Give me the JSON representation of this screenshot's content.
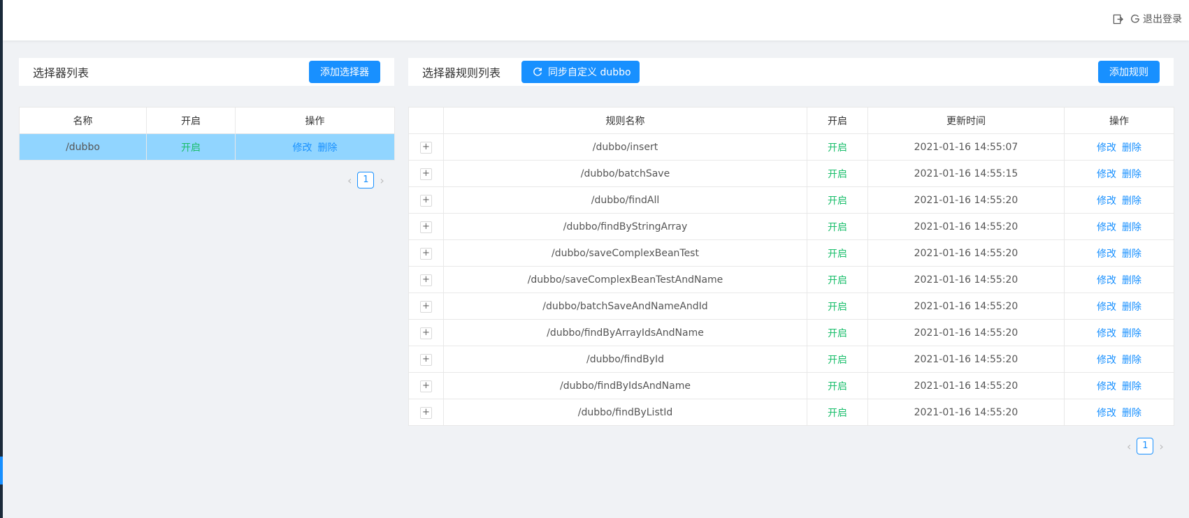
{
  "header": {
    "logout_label": "退出登录"
  },
  "selector_panel": {
    "title": "选择器列表",
    "add_button": "添加选择器",
    "columns": [
      "名称",
      "开启",
      "操作"
    ],
    "rows": [
      {
        "name": "/dubbo",
        "status": "开启",
        "edit": "修改",
        "delete": "删除"
      }
    ],
    "page": "1"
  },
  "rule_panel": {
    "title": "选择器规则列表",
    "sync_button": "同步自定义 dubbo",
    "add_button": "添加规则",
    "columns": [
      "",
      "规则名称",
      "开启",
      "更新时间",
      "操作"
    ],
    "rows": [
      {
        "name": "/dubbo/insert",
        "status": "开启",
        "time": "2021-01-16 14:55:07",
        "edit": "修改",
        "delete": "删除"
      },
      {
        "name": "/dubbo/batchSave",
        "status": "开启",
        "time": "2021-01-16 14:55:15",
        "edit": "修改",
        "delete": "删除"
      },
      {
        "name": "/dubbo/findAll",
        "status": "开启",
        "time": "2021-01-16 14:55:20",
        "edit": "修改",
        "delete": "删除"
      },
      {
        "name": "/dubbo/findByStringArray",
        "status": "开启",
        "time": "2021-01-16 14:55:20",
        "edit": "修改",
        "delete": "删除"
      },
      {
        "name": "/dubbo/saveComplexBeanTest",
        "status": "开启",
        "time": "2021-01-16 14:55:20",
        "edit": "修改",
        "delete": "删除"
      },
      {
        "name": "/dubbo/saveComplexBeanTestAndName",
        "status": "开启",
        "time": "2021-01-16 14:55:20",
        "edit": "修改",
        "delete": "删除"
      },
      {
        "name": "/dubbo/batchSaveAndNameAndId",
        "status": "开启",
        "time": "2021-01-16 14:55:20",
        "edit": "修改",
        "delete": "删除"
      },
      {
        "name": "/dubbo/findByArrayIdsAndName",
        "status": "开启",
        "time": "2021-01-16 14:55:20",
        "edit": "修改",
        "delete": "删除"
      },
      {
        "name": "/dubbo/findById",
        "status": "开启",
        "time": "2021-01-16 14:55:20",
        "edit": "修改",
        "delete": "删除"
      },
      {
        "name": "/dubbo/findByIdsAndName",
        "status": "开启",
        "time": "2021-01-16 14:55:20",
        "edit": "修改",
        "delete": "删除"
      },
      {
        "name": "/dubbo/findByListId",
        "status": "开启",
        "time": "2021-01-16 14:55:20",
        "edit": "修改",
        "delete": "删除"
      }
    ],
    "expand_symbol": "+",
    "page": "1"
  },
  "icons": {
    "export": "export-icon",
    "logout": "logout-icon",
    "sync": "sync-icon",
    "prev": "chevron-left-icon",
    "next": "chevron-right-icon"
  },
  "colors": {
    "primary": "#1890ff",
    "status_on": "#19be6b",
    "selected_row": "#91d5ff",
    "background": "#f0f2f5"
  }
}
